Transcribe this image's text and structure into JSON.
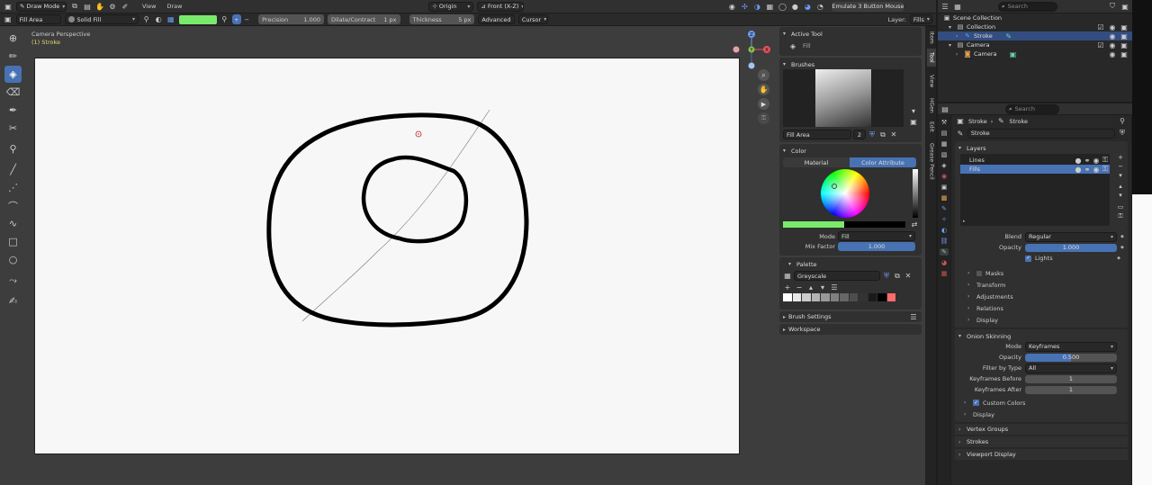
{
  "header": {
    "mode": "Draw Mode",
    "menu": [
      "View",
      "Draw"
    ],
    "pivot": "Origin",
    "view_axis": "Front (X-Z)",
    "emulate": "Emulate 3 Button Mouse",
    "search_placeholder": "Search"
  },
  "tool_settings": {
    "tool": "Fill Area",
    "fill_mode": "Solid Fill",
    "fill_color": "#7aea6c",
    "precision_label": "Precision",
    "precision_value": "1.000",
    "dilate_label": "Dilate/Contract",
    "dilate_value": "1 px",
    "thickness_label": "Thickness",
    "thickness_value": "5 px",
    "advanced": "Advanced",
    "cursor": "Cursor",
    "layer_label": "Layer:",
    "layer_value": "Fills"
  },
  "viewport": {
    "view_name": "Camera Perspective",
    "object_name": "(1) Stroke",
    "axis_labels": {
      "z": "Z",
      "y": "Y",
      "x": "X"
    }
  },
  "sidepanel": {
    "tabs": [
      "Item",
      "Tool",
      "View",
      "HGen",
      "Edit",
      "Grease Pencil"
    ],
    "active_tool": {
      "title": "Active Tool",
      "name": "Fill"
    },
    "brushes": {
      "title": "Brushes",
      "name": "Fill Area",
      "users": "2"
    },
    "color": {
      "title": "Color",
      "tabs": [
        "Material",
        "Color Attribute"
      ],
      "mode_label": "Mode",
      "mode_value": "Fill",
      "mix_label": "Mix Factor",
      "mix_value": "1.000"
    },
    "palette": {
      "title": "Palette",
      "name": "Greyscale",
      "swatches": [
        "#ffffff",
        "#e6e6e6",
        "#cccccc",
        "#b3b3b3",
        "#999999",
        "#808080",
        "#666666",
        "#4d4d4d",
        "#333333",
        "#1a1a1a",
        "#000000",
        "#ff6b6b"
      ]
    },
    "brush_settings": "Brush Settings",
    "workspace": "Workspace"
  },
  "outliner": {
    "search_placeholder": "Search",
    "items": [
      {
        "label": "Scene Collection",
        "level": 0
      },
      {
        "label": "Collection",
        "level": 1
      },
      {
        "label": "Stroke",
        "level": 2,
        "selected": true
      },
      {
        "label": "Camera",
        "level": 1
      },
      {
        "label": "Camera",
        "level": 2
      }
    ]
  },
  "properties": {
    "search_placeholder": "Search",
    "breadcrumb": [
      "Stroke",
      "Stroke"
    ],
    "datablock": "Stroke",
    "layers_title": "Layers",
    "layers": [
      "Lines",
      "Fills"
    ],
    "blend_label": "Blend",
    "blend_value": "Regular",
    "opacity_label": "Opacity",
    "opacity_value": "1.000",
    "lights_label": "Lights",
    "subpanels": [
      "Masks",
      "Transform",
      "Adjustments",
      "Relations",
      "Display"
    ],
    "onion": {
      "title": "Onion Skinning",
      "mode_label": "Mode",
      "mode_value": "Keyframes",
      "opacity_label": "Opacity",
      "opacity_value": "0.500",
      "filter_label": "Filter by Type",
      "filter_value": "All",
      "before_label": "Keyframes Before",
      "before_value": "1",
      "after_label": "Keyframes After",
      "after_value": "1",
      "custom_colors": "Custom Colors",
      "display": "Display"
    },
    "bottom_panels": [
      "Vertex Groups",
      "Strokes",
      "Viewport Display"
    ]
  }
}
